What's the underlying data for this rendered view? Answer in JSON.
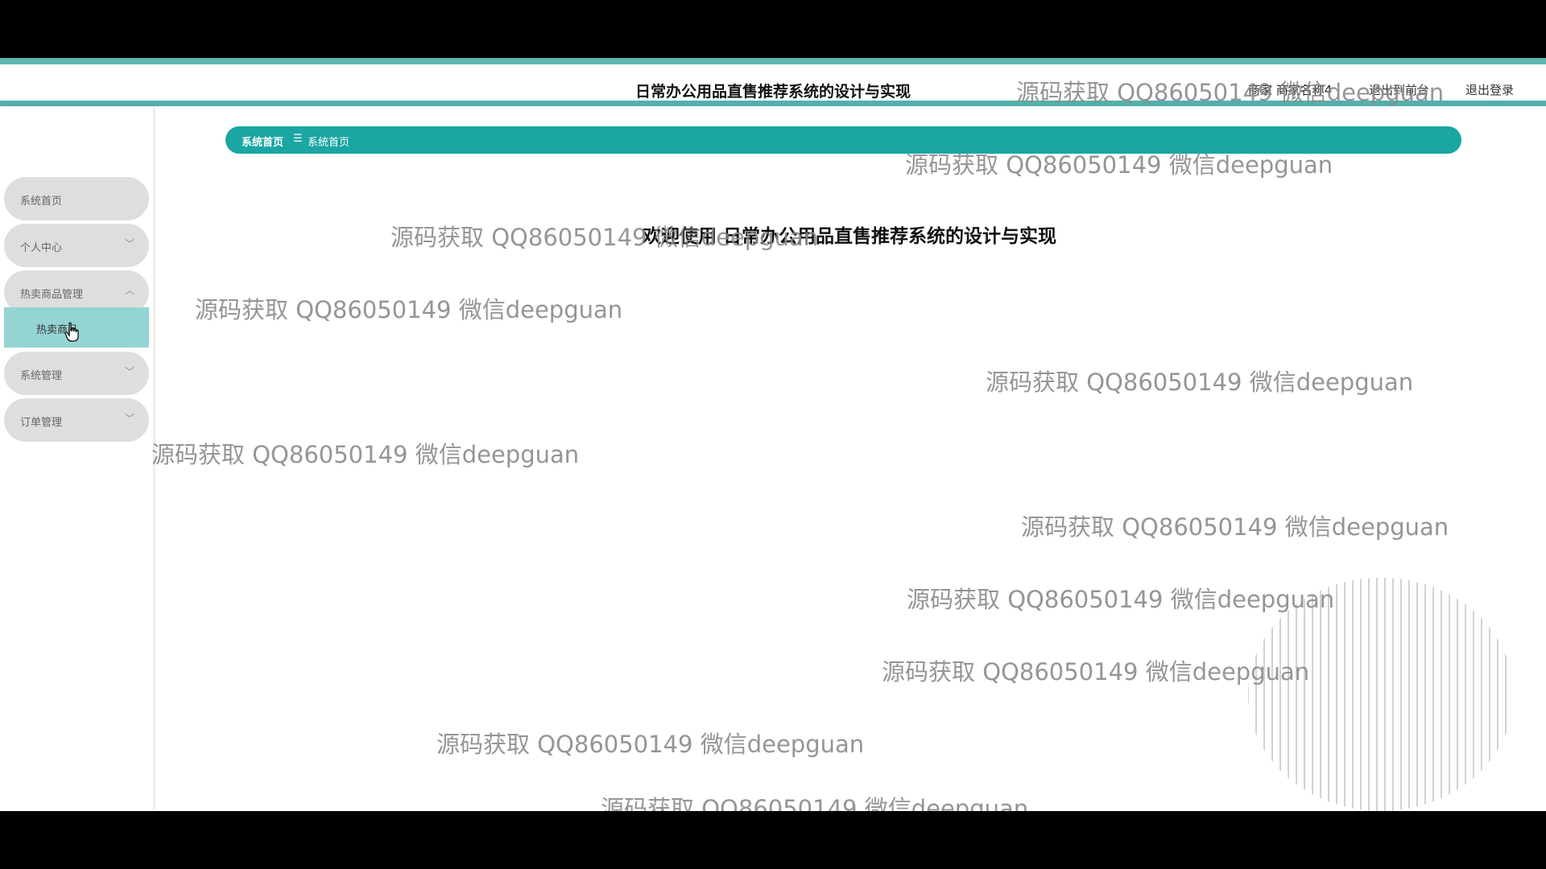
{
  "header": {
    "title": "日常办公用品直售推荐系统的设计与实现",
    "user_label": "商家 商家名称4",
    "front_link": "退出到前台",
    "logout_link": "退出登录"
  },
  "sidebar": {
    "items": [
      {
        "label": "系统首页"
      },
      {
        "label": "个人中心"
      },
      {
        "label": "热卖商品管理"
      },
      {
        "label": "系统管理"
      },
      {
        "label": "订单管理"
      }
    ],
    "sub_item": "热卖商品"
  },
  "breadcrumb": {
    "home": "系统首页",
    "separator": "☰",
    "current": "系统首页"
  },
  "main": {
    "welcome": "欢迎使用 日常办公用品直售推荐系统的设计与实现"
  },
  "watermark": {
    "text": "源码获取 QQ86050149 微信deepguan"
  },
  "colors": {
    "accent": "#1aa6a3",
    "active_sub": "#94d5d4",
    "menu_bg": "#dedede"
  }
}
